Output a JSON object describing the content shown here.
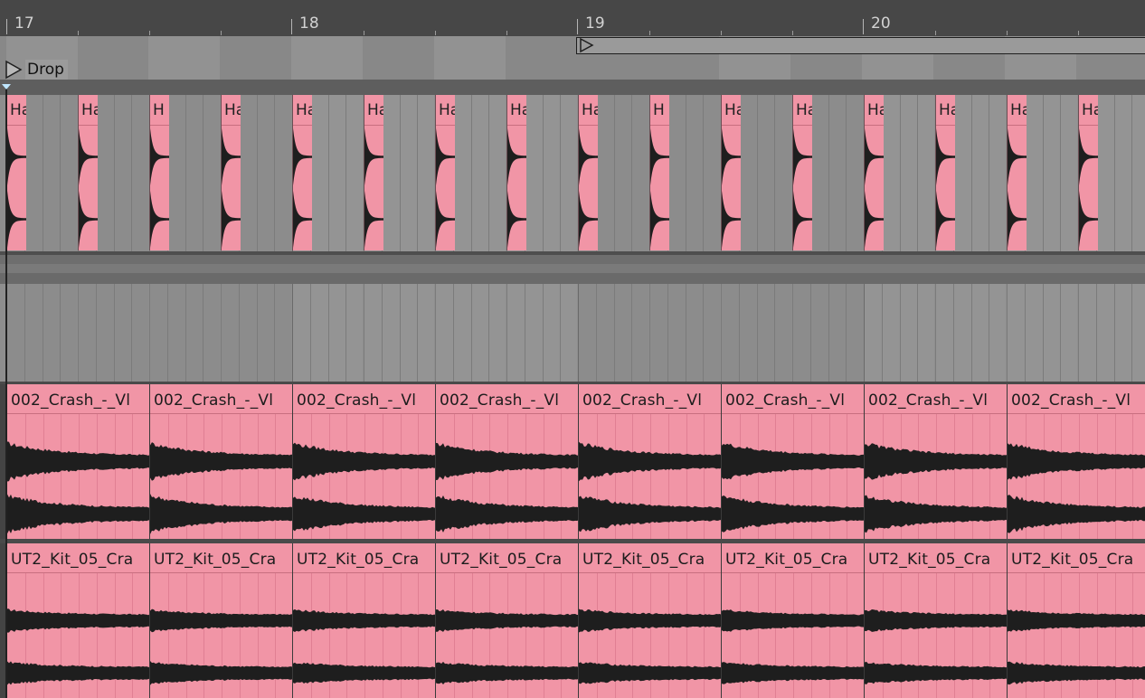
{
  "ruler": {
    "bars": [
      "17",
      "18",
      "19",
      "20"
    ]
  },
  "locators": {
    "drop": "Drop"
  },
  "tracks": {
    "hats": {
      "clip_label": "Ha",
      "clip_label_short": "H"
    },
    "crash": {
      "clip_label": "002_Crash_-_Vl"
    },
    "kit": {
      "clip_label": "UT2_Kit_05_Cra"
    }
  },
  "colors": {
    "clip": "#f195a6",
    "ruler": "#474747",
    "waveform": "#1e1e1e",
    "playhead_marker": "#bfe6ff"
  },
  "icons": {
    "locator": "triangle-right-icon",
    "loop_start": "triangle-right-icon"
  }
}
